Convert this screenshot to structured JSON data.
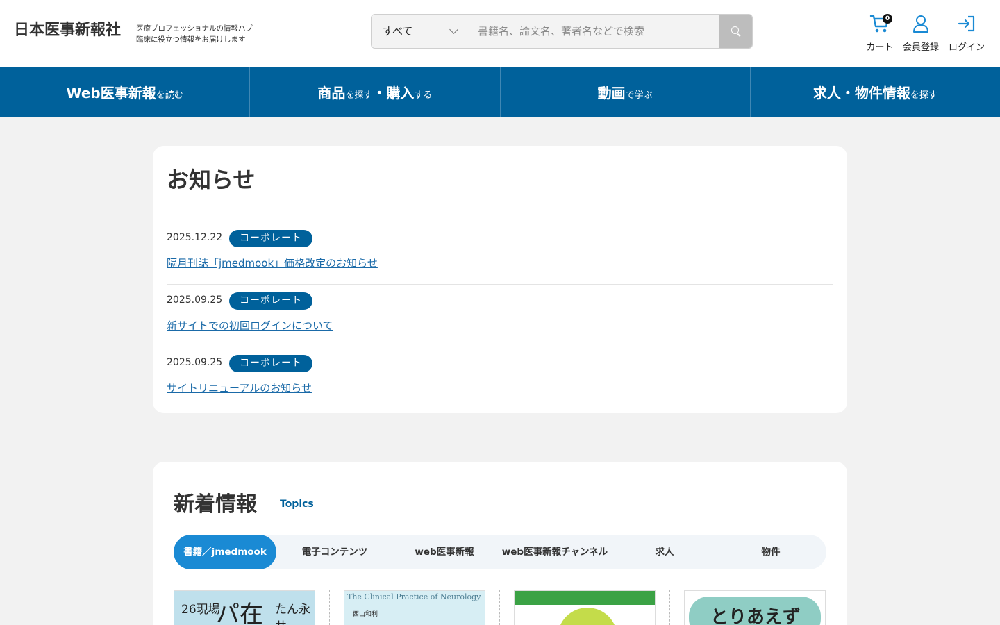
{
  "header": {
    "logo": "日本医事新報社",
    "tagline_line1": "医療プロフェッショナルの情報ハブ",
    "tagline_line2": "臨床に役立つ情報をお届けします",
    "search": {
      "category": "すべて",
      "placeholder": "書籍名、論文名、著者名などで検索"
    },
    "icons": {
      "cart_label": "カート",
      "cart_count": "0",
      "register_label": "会員登録",
      "login_label": "ログイン"
    }
  },
  "nav": [
    {
      "big": "Web医事新報",
      "small": "を読む"
    },
    {
      "big": "商品",
      "small": "を探す",
      "big2": "・購入",
      "small2": "する"
    },
    {
      "big": "動画",
      "small": "で学ぶ"
    },
    {
      "big": "求人・物件情報",
      "small": "を探す"
    }
  ],
  "notices": {
    "title": "お知らせ",
    "items": [
      {
        "date": "2025.12.22",
        "tag": "コーポレート",
        "text": "隔月刊誌「jmedmook」価格改定のお知らせ"
      },
      {
        "date": "2025.09.25",
        "tag": "コーポレート",
        "text": "新サイトでの初回ログインについて"
      },
      {
        "date": "2025.09.25",
        "tag": "コーポレート",
        "text": "サイトリニューアルのお知らせ"
      }
    ]
  },
  "topics": {
    "title": "新着情報",
    "subtitle": "Topics",
    "tabs": [
      "書籍／jmedmook",
      "電子コンテンツ",
      "web医事新報",
      "web医事新報チャンネル",
      "求人",
      "物件"
    ],
    "active_tab": 0,
    "books": [
      {
        "cover_text_1": "26現場",
        "cover_text_2": "パ在",
        "cover_text_3": "たん永井"
      },
      {
        "cover_text_1": "The Clinical Practice of Neurology",
        "cover_text_2": "西山和利"
      },
      {
        "cover_text_1": ""
      },
      {
        "cover_text_1": "とりあえず"
      }
    ]
  },
  "colors": {
    "brand_blue": "#00619b",
    "active_tab": "#1a8ad4",
    "link": "#1a6aa8"
  }
}
